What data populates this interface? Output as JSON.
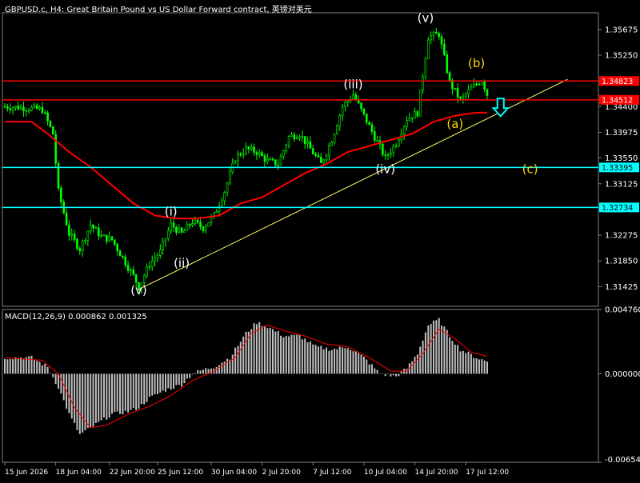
{
  "header": {
    "title": "GBPUSD.c, H4:  Great Britain Pound vs US Dollar Forward contract, 英镑对美元"
  },
  "macd_header": {
    "label": "MACD(12,26,9) 0.000862 0.001325"
  },
  "colors": {
    "background": "#000000",
    "grid": "#3a3a3a",
    "bull_candle": "#00ff00",
    "bear_candle": "#00ff00",
    "moving_average": "#ff0000",
    "resistance_line": "#ff0000",
    "support_line": "#00ffff",
    "trendline": "#ffff66",
    "histogram": "#c0c0c0",
    "signal_line": "#ff0000",
    "wave_label_white": "#ffffff",
    "wave_label_yellow": "#ffd700",
    "arrow": "#00ffff"
  },
  "chart_data": [
    {
      "type": "candlestick",
      "symbol": "GBPUSD.c",
      "timeframe": "H4",
      "ylim": [
        1.311,
        1.3595
      ],
      "y_ticks": [
        "1.35675",
        "1.35250",
        "1.34823",
        "1.34400",
        "1.33975",
        "1.33550",
        "1.33125",
        "1.32700",
        "1.32275",
        "1.31850",
        "1.31425"
      ],
      "x_ticks": [
        "15 Jun 2026",
        "18 Jun 04:00",
        "22 Jun 20:00",
        "25 Jun 12:00",
        "30 Jun 04:00",
        "2 Jul 20:00",
        "7 Jul 12:00",
        "10 Jul 04:00",
        "14 Jul 20:00",
        "17 Jul 12:00"
      ],
      "price_series": [
        {
          "i": 0,
          "p": 1.344
        },
        {
          "i": 8,
          "p": 1.3438
        },
        {
          "i": 14,
          "p": 1.3435
        },
        {
          "i": 18,
          "p": 1.3395
        },
        {
          "i": 20,
          "p": 1.33
        },
        {
          "i": 24,
          "p": 1.323
        },
        {
          "i": 28,
          "p": 1.3205
        },
        {
          "i": 32,
          "p": 1.3245
        },
        {
          "i": 36,
          "p": 1.3225
        },
        {
          "i": 40,
          "p": 1.322
        },
        {
          "i": 44,
          "p": 1.319
        },
        {
          "i": 48,
          "p": 1.316
        },
        {
          "i": 50,
          "p": 1.3142
        },
        {
          "i": 54,
          "p": 1.318
        },
        {
          "i": 58,
          "p": 1.32
        },
        {
          "i": 62,
          "p": 1.3245
        },
        {
          "i": 66,
          "p": 1.323
        },
        {
          "i": 70,
          "p": 1.325
        },
        {
          "i": 74,
          "p": 1.324
        },
        {
          "i": 78,
          "p": 1.326
        },
        {
          "i": 82,
          "p": 1.33
        },
        {
          "i": 86,
          "p": 1.3355
        },
        {
          "i": 90,
          "p": 1.337
        },
        {
          "i": 94,
          "p": 1.3365
        },
        {
          "i": 98,
          "p": 1.335
        },
        {
          "i": 102,
          "p": 1.3345
        },
        {
          "i": 106,
          "p": 1.339
        },
        {
          "i": 110,
          "p": 1.3395
        },
        {
          "i": 114,
          "p": 1.337
        },
        {
          "i": 118,
          "p": 1.3345
        },
        {
          "i": 122,
          "p": 1.3385
        },
        {
          "i": 126,
          "p": 1.344
        },
        {
          "i": 130,
          "p": 1.346
        },
        {
          "i": 134,
          "p": 1.3425
        },
        {
          "i": 138,
          "p": 1.339
        },
        {
          "i": 142,
          "p": 1.3355
        },
        {
          "i": 146,
          "p": 1.338
        },
        {
          "i": 150,
          "p": 1.342
        },
        {
          "i": 154,
          "p": 1.343
        },
        {
          "i": 158,
          "p": 1.3555
        },
        {
          "i": 162,
          "p": 1.356
        },
        {
          "i": 166,
          "p": 1.348
        },
        {
          "i": 170,
          "p": 1.345
        },
        {
          "i": 174,
          "p": 1.347
        },
        {
          "i": 178,
          "p": 1.3485
        },
        {
          "i": 180,
          "p": 1.346
        }
      ],
      "moving_average": [
        {
          "i": 0,
          "p": 1.3415
        },
        {
          "i": 10,
          "p": 1.3415
        },
        {
          "i": 16,
          "p": 1.3395
        },
        {
          "i": 24,
          "p": 1.3365
        },
        {
          "i": 32,
          "p": 1.334
        },
        {
          "i": 40,
          "p": 1.331
        },
        {
          "i": 48,
          "p": 1.328
        },
        {
          "i": 56,
          "p": 1.326
        },
        {
          "i": 64,
          "p": 1.3255
        },
        {
          "i": 72,
          "p": 1.3255
        },
        {
          "i": 80,
          "p": 1.326
        },
        {
          "i": 88,
          "p": 1.328
        },
        {
          "i": 96,
          "p": 1.329
        },
        {
          "i": 104,
          "p": 1.331
        },
        {
          "i": 112,
          "p": 1.333
        },
        {
          "i": 120,
          "p": 1.3345
        },
        {
          "i": 128,
          "p": 1.3365
        },
        {
          "i": 136,
          "p": 1.3375
        },
        {
          "i": 144,
          "p": 1.3385
        },
        {
          "i": 152,
          "p": 1.3395
        },
        {
          "i": 160,
          "p": 1.3415
        },
        {
          "i": 168,
          "p": 1.3425
        },
        {
          "i": 176,
          "p": 1.343
        },
        {
          "i": 180,
          "p": 1.343
        }
      ],
      "horizontal_lines": [
        {
          "price": 1.34823,
          "label": "1.34823",
          "color": "#ff0000"
        },
        {
          "price": 1.34512,
          "label": "1.34512",
          "color": "#ff0000"
        },
        {
          "price": 1.33395,
          "label": "1.33395",
          "color": "#00ffff"
        },
        {
          "price": 1.32734,
          "label": "1.32734",
          "color": "#00ffff"
        }
      ],
      "trendline": {
        "from": {
          "i": 50,
          "p": 1.3138
        },
        "to": {
          "i": 210,
          "p": 1.3485
        }
      },
      "wave_labels": [
        {
          "text": "(v)",
          "i": 50,
          "p": 1.313,
          "color": "white"
        },
        {
          "text": "(i)",
          "i": 62,
          "p": 1.326,
          "color": "white"
        },
        {
          "text": "(ii)",
          "i": 66,
          "p": 1.3175,
          "color": "white"
        },
        {
          "text": "(iii)",
          "i": 130,
          "p": 1.347,
          "color": "white"
        },
        {
          "text": "(iv)",
          "i": 142,
          "p": 1.333,
          "color": "white"
        },
        {
          "text": "(v)",
          "i": 157,
          "p": 1.358,
          "color": "white"
        },
        {
          "text": "(b)",
          "i": 176,
          "p": 1.3505,
          "color": "yellow"
        },
        {
          "text": "(a)",
          "i": 168,
          "p": 1.3405,
          "color": "yellow"
        },
        {
          "text": "(c)",
          "i": 196,
          "p": 1.333,
          "color": "yellow"
        }
      ],
      "arrow": {
        "direction": "down",
        "i": 185,
        "p": 1.344
      }
    },
    {
      "type": "macd",
      "params": "12,26,9",
      "main_value": "0.000862",
      "signal_value": "0.001325",
      "ylim": [
        -0.006543,
        0.00476
      ],
      "y_ticks": [
        "0.004760",
        "0.000000",
        "-0.006543"
      ],
      "histogram": [
        {
          "i": 0,
          "v": 0.0012
        },
        {
          "i": 10,
          "v": 0.0012
        },
        {
          "i": 16,
          "v": 0.0005
        },
        {
          "i": 20,
          "v": -0.001
        },
        {
          "i": 24,
          "v": -0.003
        },
        {
          "i": 28,
          "v": -0.0045
        },
        {
          "i": 32,
          "v": -0.004
        },
        {
          "i": 36,
          "v": -0.0035
        },
        {
          "i": 40,
          "v": -0.003
        },
        {
          "i": 46,
          "v": -0.0028
        },
        {
          "i": 50,
          "v": -0.0025
        },
        {
          "i": 54,
          "v": -0.0018
        },
        {
          "i": 60,
          "v": -0.0012
        },
        {
          "i": 66,
          "v": -0.0008
        },
        {
          "i": 70,
          "v": 0.0
        },
        {
          "i": 74,
          "v": 0.0003
        },
        {
          "i": 78,
          "v": 0.0005
        },
        {
          "i": 84,
          "v": 0.0012
        },
        {
          "i": 90,
          "v": 0.003
        },
        {
          "i": 94,
          "v": 0.0038
        },
        {
          "i": 98,
          "v": 0.0035
        },
        {
          "i": 104,
          "v": 0.0028
        },
        {
          "i": 110,
          "v": 0.0028
        },
        {
          "i": 116,
          "v": 0.002
        },
        {
          "i": 122,
          "v": 0.0018
        },
        {
          "i": 128,
          "v": 0.002
        },
        {
          "i": 134,
          "v": 0.0012
        },
        {
          "i": 140,
          "v": 0.0
        },
        {
          "i": 146,
          "v": -0.0002
        },
        {
          "i": 150,
          "v": 0.0004
        },
        {
          "i": 154,
          "v": 0.0015
        },
        {
          "i": 158,
          "v": 0.0036
        },
        {
          "i": 162,
          "v": 0.004
        },
        {
          "i": 166,
          "v": 0.0028
        },
        {
          "i": 170,
          "v": 0.0018
        },
        {
          "i": 176,
          "v": 0.0012
        },
        {
          "i": 180,
          "v": 0.0009
        }
      ],
      "signal": [
        {
          "i": 0,
          "v": 0.0012
        },
        {
          "i": 14,
          "v": 0.001
        },
        {
          "i": 20,
          "v": 0.0
        },
        {
          "i": 26,
          "v": -0.0025
        },
        {
          "i": 32,
          "v": -0.004
        },
        {
          "i": 38,
          "v": -0.0038
        },
        {
          "i": 46,
          "v": -0.003
        },
        {
          "i": 54,
          "v": -0.0024
        },
        {
          "i": 62,
          "v": -0.0016
        },
        {
          "i": 70,
          "v": -0.0005
        },
        {
          "i": 78,
          "v": 0.0002
        },
        {
          "i": 86,
          "v": 0.0012
        },
        {
          "i": 92,
          "v": 0.003
        },
        {
          "i": 98,
          "v": 0.0036
        },
        {
          "i": 104,
          "v": 0.0032
        },
        {
          "i": 112,
          "v": 0.0028
        },
        {
          "i": 120,
          "v": 0.0022
        },
        {
          "i": 128,
          "v": 0.002
        },
        {
          "i": 136,
          "v": 0.0012
        },
        {
          "i": 144,
          "v": 0.0002
        },
        {
          "i": 150,
          "v": 0.0002
        },
        {
          "i": 156,
          "v": 0.0015
        },
        {
          "i": 162,
          "v": 0.0033
        },
        {
          "i": 168,
          "v": 0.0026
        },
        {
          "i": 174,
          "v": 0.0016
        },
        {
          "i": 180,
          "v": 0.0013
        }
      ]
    }
  ]
}
